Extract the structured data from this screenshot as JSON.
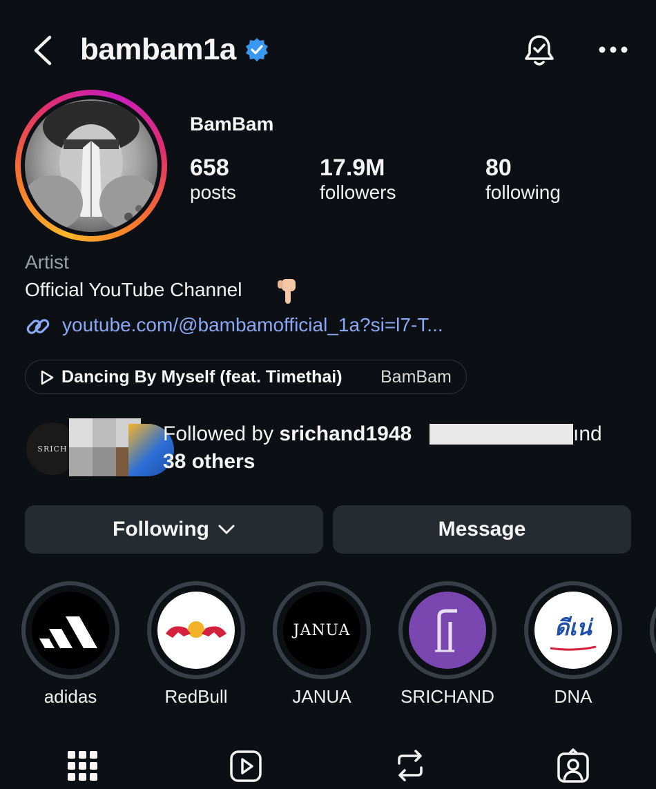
{
  "header": {
    "username": "bambam1a"
  },
  "profile": {
    "display_name": "BamBam",
    "stats": [
      {
        "value": "658",
        "label": "posts"
      },
      {
        "value": "17.9M",
        "label": "followers"
      },
      {
        "value": "80",
        "label": "following"
      }
    ],
    "category": "Artist",
    "bio": "Official YouTube Channel",
    "link": "youtube.com/@bambamofficial_1a?si=l7-T..."
  },
  "music": {
    "title": "Dancing By Myself (feat. Timethai)",
    "artist": "BamBam"
  },
  "followed_by": {
    "prefix": "Followed by ",
    "name": "srichand1948",
    "suffix": "ınd",
    "others": "38 others",
    "avatar_label": "SRICH"
  },
  "buttons": {
    "following": "Following",
    "message": "Message"
  },
  "highlights": [
    {
      "label": "adidas"
    },
    {
      "label": "RedBull"
    },
    {
      "label": "JANUA",
      "logo_text": "JANUA"
    },
    {
      "label": "SRICHAND"
    },
    {
      "label": "DNA",
      "logo_text": "ดีเน่"
    }
  ],
  "colors": {
    "background": "#0c0f14",
    "verified": "#3897f0",
    "link": "#8aa8f5",
    "button_bg": "#262a31"
  }
}
